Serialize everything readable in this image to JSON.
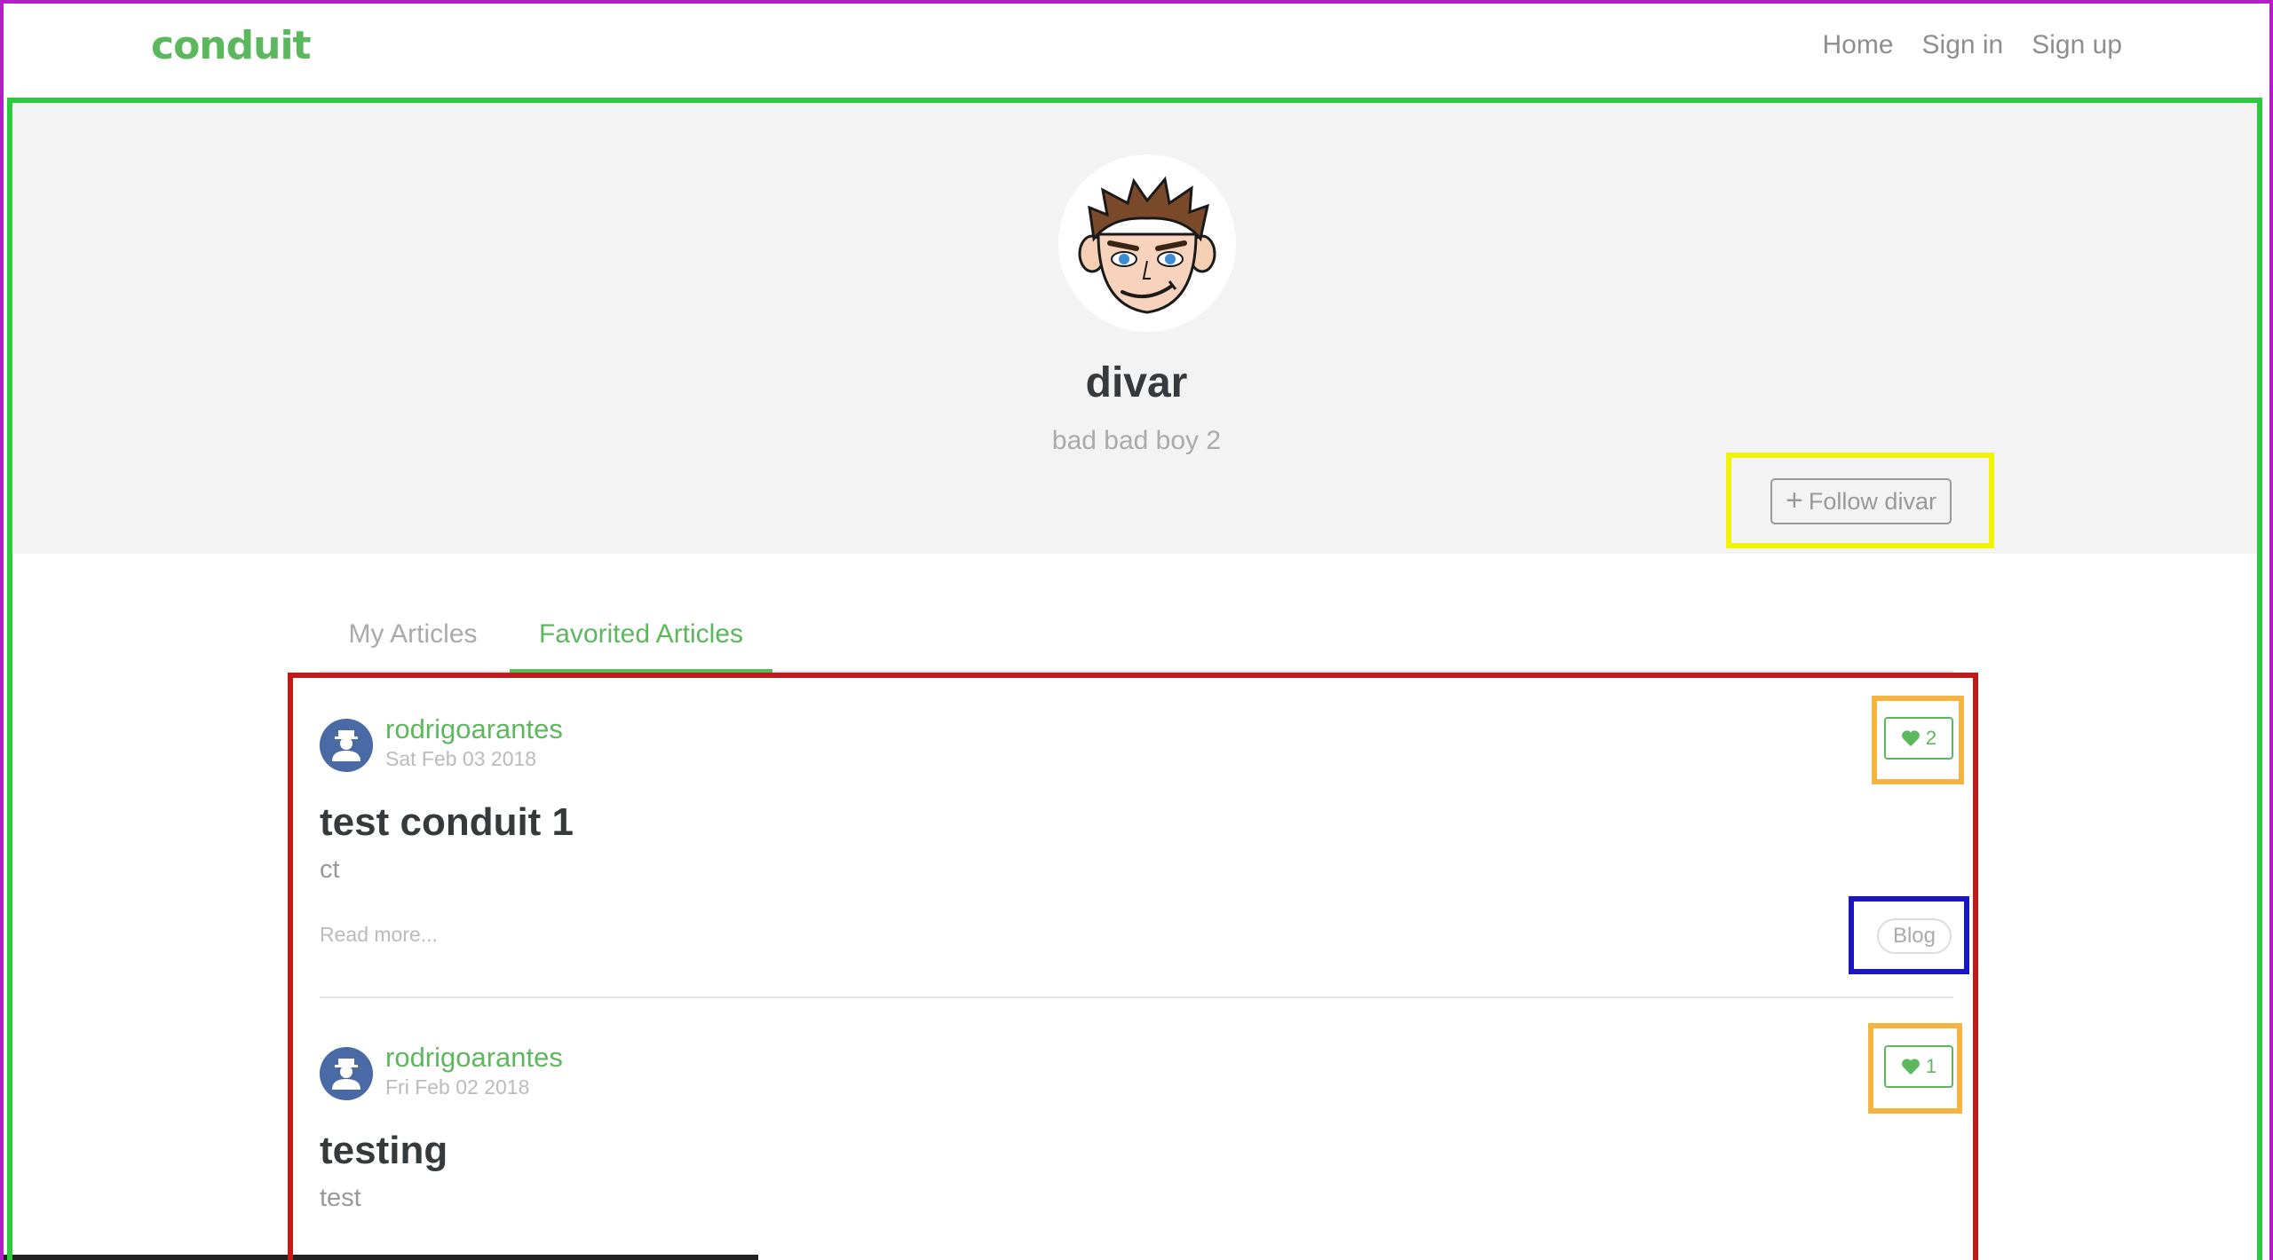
{
  "navbar": {
    "brand": "conduit",
    "links": [
      "Home",
      "Sign in",
      "Sign up"
    ]
  },
  "profile": {
    "username": "divar",
    "bio": "bad bad boy 2",
    "follow_label": "Follow divar"
  },
  "tabs": [
    "My Articles",
    "Favorited Articles"
  ],
  "active_tab": "Favorited Articles",
  "articles": [
    {
      "author": "rodrigoarantes",
      "date": "Sat Feb 03 2018",
      "favorites": "2",
      "title": "test conduit 1",
      "description": "ct",
      "read_more": "Read more...",
      "tags": [
        "Blog"
      ]
    },
    {
      "author": "rodrigoarantes",
      "date": "Fri Feb 02 2018",
      "favorites": "1",
      "title": "testing",
      "description": "test"
    }
  ],
  "colors": {
    "brand": "#5cb85c",
    "banner": "#f3f3f3",
    "annotation_page": "#b41ec8",
    "annotation_main": "#2ec93e",
    "annotation_follow": "#f2f30a",
    "annotation_list": "#c01a1a",
    "annotation_favorite": "#f5b441",
    "annotation_tag": "#1a16c0"
  },
  "icons": {
    "follow": "plus-icon",
    "favorite": "heart-icon"
  }
}
